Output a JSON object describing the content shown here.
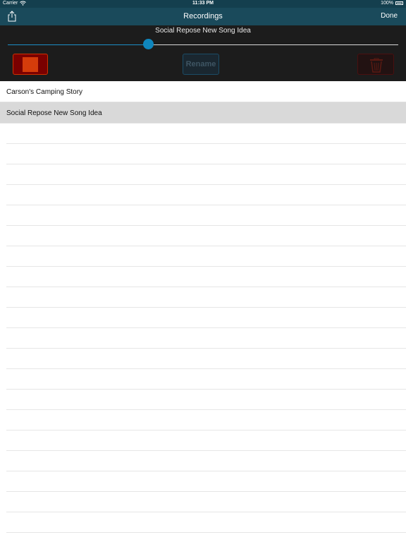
{
  "status": {
    "carrier": "Carrier",
    "time": "11:33 PM",
    "battery": "100%"
  },
  "nav": {
    "title": "Recordings",
    "done_label": "Done"
  },
  "player": {
    "now_playing": "Social Repose New Song Idea",
    "progress": 0.36,
    "rename_label": "Rename"
  },
  "recordings": [
    {
      "name": "Carson's Camping Story",
      "selected": false
    },
    {
      "name": "Social Repose New Song Idea",
      "selected": true
    }
  ],
  "colors": {
    "nav_bg": "#1a4a5b",
    "accent": "#0f86bd",
    "stop": "#d53c0b",
    "selected_row": "#d9d9d9"
  }
}
